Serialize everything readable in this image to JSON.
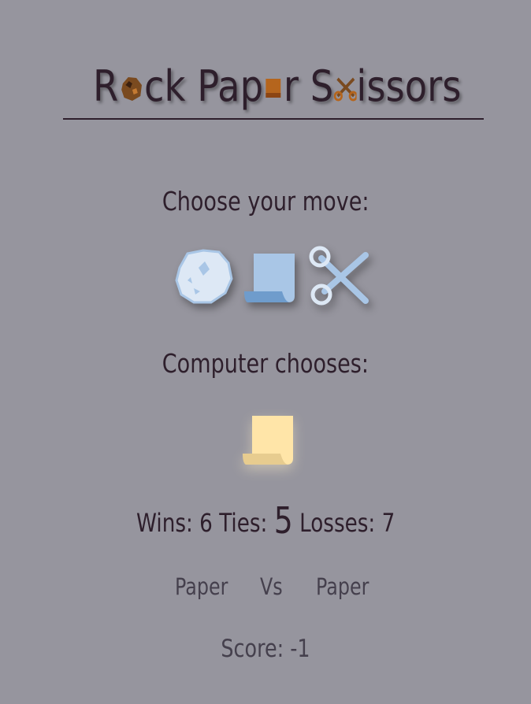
{
  "title": {
    "part1": "R",
    "part2": "ck Pap",
    "part3": "r S",
    "part4": "issors"
  },
  "prompt": "Choose your move:",
  "moves": [
    {
      "name": "rock",
      "icon": "rock-icon"
    },
    {
      "name": "paper",
      "icon": "paper-icon"
    },
    {
      "name": "scissors",
      "icon": "scissors-icon"
    }
  ],
  "computer": {
    "label": "Computer chooses:",
    "choice_icon": "paper-icon"
  },
  "stats": {
    "wins_label": "Wins:",
    "wins": "6",
    "ties_label": "Ties:",
    "ties": "5",
    "losses_label": "Losses:",
    "losses": "7"
  },
  "round": {
    "player_move": "Paper",
    "vs": "Vs",
    "computer_move": "Paper"
  },
  "score": "Score: -1",
  "colors": {
    "background": "#96959e",
    "text": "#2e1f2c",
    "player_icons": "#a9c6e6",
    "computer_icon": "#ffe5a8",
    "title_icons": "#8b4513"
  }
}
